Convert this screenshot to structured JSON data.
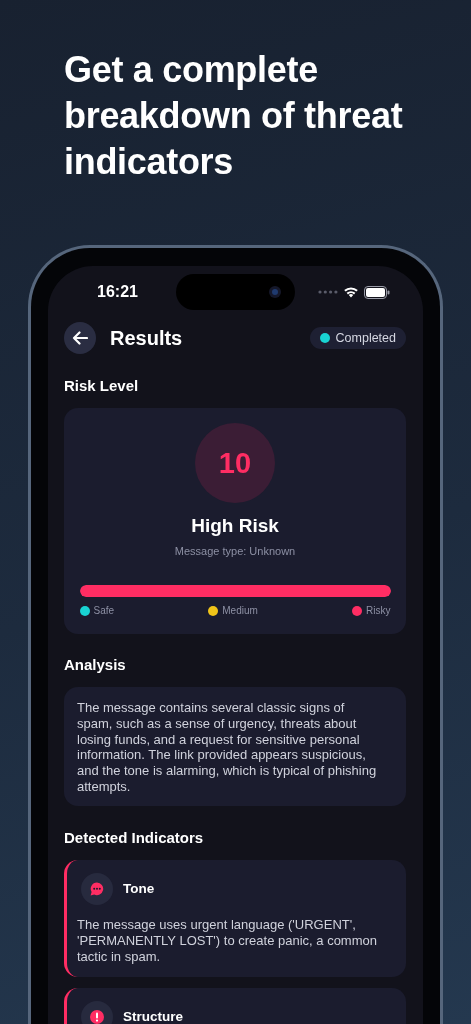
{
  "headline": "Get a complete breakdown of threat indicators",
  "status_bar": {
    "time": "16:21"
  },
  "header": {
    "title": "Results",
    "status": {
      "label": "Completed",
      "color": "#19d3d3"
    }
  },
  "risk": {
    "section_title": "Risk Level",
    "score": "10",
    "label": "High Risk",
    "message_type": "Message type: Unknown",
    "meter": {
      "level": 1.0
    },
    "legend": [
      {
        "label": "Safe",
        "color": "#19d3d3"
      },
      {
        "label": "Medium",
        "color": "#f0c419"
      },
      {
        "label": "Risky",
        "color": "#ff2d63"
      }
    ]
  },
  "analysis": {
    "section_title": "Analysis",
    "text": "The message contains several classic signs of spam, such as a sense of urgency, threats about losing funds, and a request for sensitive personal information. The link provided appears suspicious, and the tone is alarming, which is typical of phishing attempts."
  },
  "indicators": {
    "section_title": "Detected Indicators",
    "items": [
      {
        "kind": "message",
        "title": "Tone",
        "description": "The message uses urgent language ('URGENT', 'PERMANENTLY LOST') to create panic, a common tactic in spam."
      },
      {
        "kind": "alert",
        "title": "Structure"
      }
    ]
  }
}
